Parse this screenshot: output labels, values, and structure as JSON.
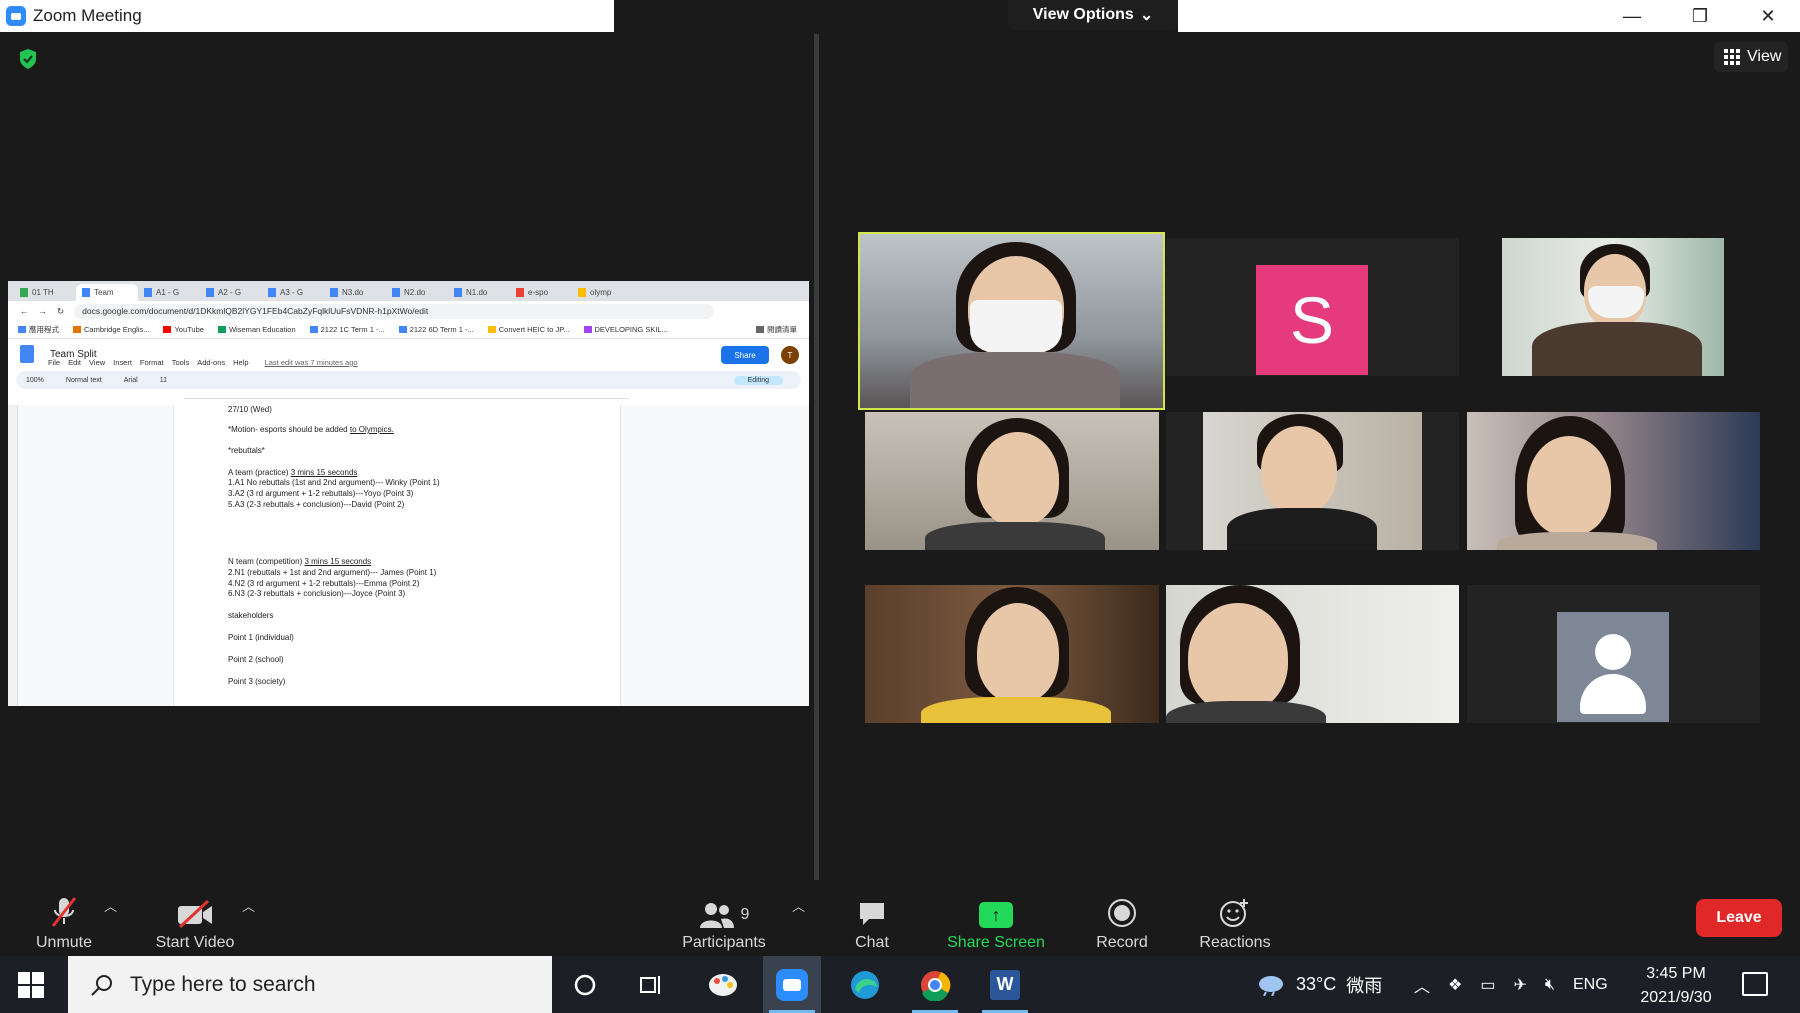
{
  "window": {
    "title": "Zoom Meeting",
    "view_options": "View Options",
    "view_button": "View"
  },
  "shared_screen": {
    "tabs": [
      "01 TH",
      "Team",
      "A1 - G",
      "A2 - G",
      "A3 - G",
      "N3.do",
      "N2.do",
      "N1.do",
      "e-spo",
      "olymp"
    ],
    "url": "docs.google.com/document/d/1DKkmlQB2lYGY1FEb4CabZyFqlklUuFsVDNR-h1pXtWo/edit",
    "bookmarks": [
      "應用程式",
      "Cambridge Englis...",
      "YouTube",
      "Wiseman Education",
      "2122 1C Term 1 -...",
      "2122 6D Term 1 -...",
      "Convert HEIC to JP...",
      "DEVELOPING SKIL...",
      "閱讀清單"
    ],
    "doc_title": "Team Split",
    "menu": [
      "File",
      "Edit",
      "View",
      "Insert",
      "Format",
      "Tools",
      "Add-ons",
      "Help"
    ],
    "last_edit": "Last edit was 7 minutes ago",
    "share_label": "Share",
    "avatar_letter": "T",
    "toolbar": {
      "zoom": "100%",
      "style": "Normal text",
      "font": "Arial",
      "size": "11",
      "mode": "Editing"
    },
    "lines": [
      {
        "text": "27/10 (Wed)",
        "u": ""
      },
      {
        "text": "*Motion- esports should be added ",
        "u": "to Olympics."
      },
      {
        "text": "*rebuttals*",
        "u": ""
      },
      {
        "text": "A team (practice) ",
        "u": "3 mins 15 seconds"
      },
      {
        "text": "1.A1 No rebuttals (1st and 2nd argument)--- Winky (Point 1)",
        "u": ""
      },
      {
        "text": "3.A2 (3 rd argument + 1-2 rebuttals)---Yoyo (Point 3)",
        "u": ""
      },
      {
        "text": "5.A3 (2-3 rebuttals + conclusion)---David (Point 2)",
        "u": ""
      },
      {
        "text": "N team (competition) ",
        "u": "3 mins 15 seconds"
      },
      {
        "text": "2.N1 (rebuttals + 1st and 2nd argument)--- James (Point 1)",
        "u": ""
      },
      {
        "text": "4.N2 (3 rd argument + 1-2 rebuttals)---Emma (Point 2)",
        "u": ""
      },
      {
        "text": "6.N3 (2-3 rebuttals + conclusion)---Joyce (Point 3)",
        "u": ""
      },
      {
        "text": "stakeholders",
        "u": ""
      },
      {
        "text": "Point 1 (individual)",
        "u": ""
      },
      {
        "text": "Point 2 (school)",
        "u": ""
      },
      {
        "text": "Point 3 (society)",
        "u": ""
      }
    ]
  },
  "gallery": {
    "active_tile": 0,
    "tiles": [
      {
        "kind": "video",
        "desc": "masked-girl"
      },
      {
        "kind": "avatar",
        "letter": "S",
        "color": "#e63a7e"
      },
      {
        "kind": "video",
        "desc": "masked-teacher"
      },
      {
        "kind": "video",
        "desc": "girl-1"
      },
      {
        "kind": "video",
        "desc": "boy-glasses"
      },
      {
        "kind": "video",
        "desc": "girl-2"
      },
      {
        "kind": "video",
        "desc": "girl-3"
      },
      {
        "kind": "video",
        "desc": "girl-glasses"
      },
      {
        "kind": "placeholder"
      }
    ]
  },
  "toolbar": {
    "unmute": "Unmute",
    "start_video": "Start Video",
    "participants": "Participants",
    "participants_count": "9",
    "chat": "Chat",
    "share_screen": "Share Screen",
    "record": "Record",
    "reactions": "Reactions",
    "leave": "Leave",
    "share_color": "#23d959",
    "leave_color": "#e02828"
  },
  "taskbar": {
    "search_placeholder": "Type here to search",
    "weather_temp": "33°C",
    "weather_desc": "微雨",
    "language": "ENG",
    "time": "3:45 PM",
    "date": "2021/9/30"
  }
}
